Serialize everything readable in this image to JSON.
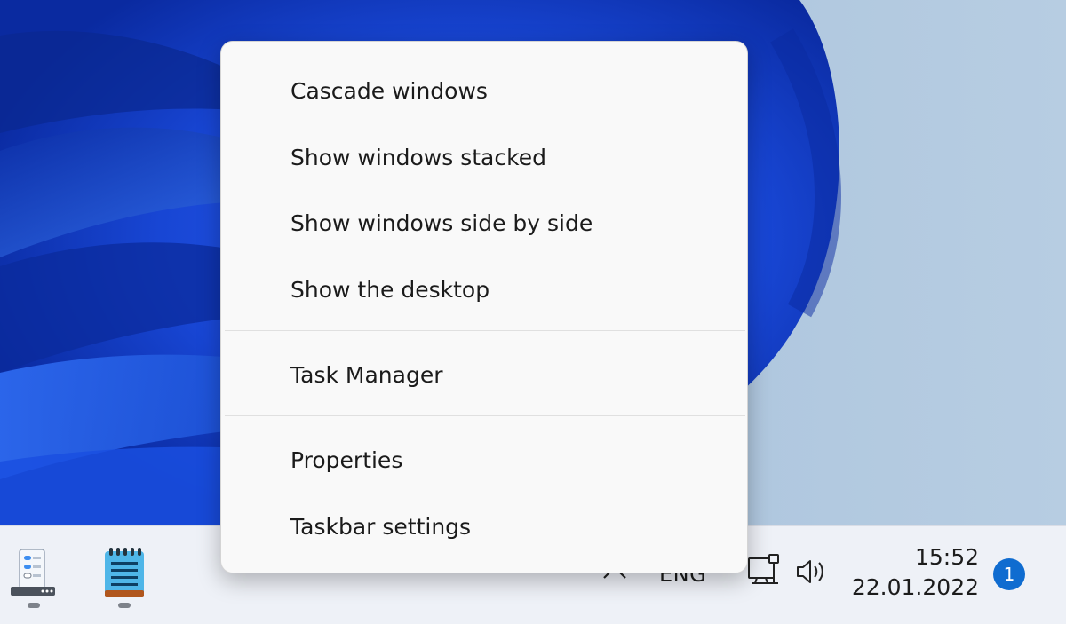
{
  "context_menu": {
    "items": [
      {
        "label": "Cascade windows"
      },
      {
        "label": "Show windows stacked"
      },
      {
        "label": "Show windows side by side"
      },
      {
        "label": "Show the desktop"
      },
      {
        "label": "Task Manager"
      },
      {
        "label": "Properties"
      },
      {
        "label": "Taskbar settings"
      }
    ]
  },
  "taskbar": {
    "apps": [
      {
        "icon": "settings-app-icon"
      },
      {
        "icon": "notepad-icon"
      }
    ],
    "tray": {
      "chevron_icon": "chevron-up-icon",
      "language": "ENG",
      "network_icon": "network-icon",
      "volume_icon": "volume-icon",
      "time": "15:52",
      "date": "22.01.2022",
      "notification_count": "1"
    }
  },
  "colors": {
    "accent": "#0f6cd0",
    "menu_background": "#f9f9f9",
    "taskbar_background": "#eef1f7",
    "wallpaper_primary": "#1240c8"
  }
}
